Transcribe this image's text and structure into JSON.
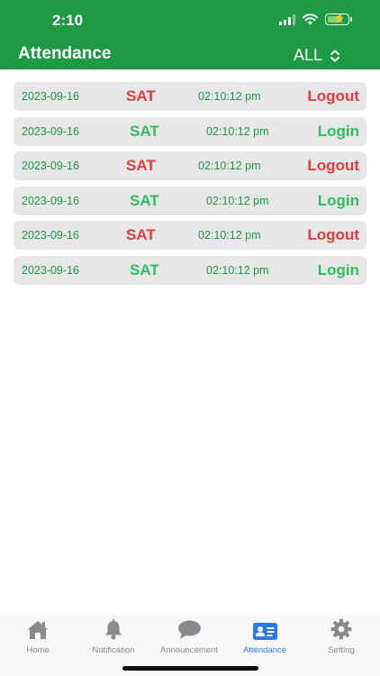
{
  "status_bar": {
    "time": "2:10"
  },
  "header": {
    "title": "Attendance",
    "filter_value": "ALL"
  },
  "records": [
    {
      "date": "2023-09-16",
      "day": "SAT",
      "time": "02:10:12 pm",
      "action": "Logout",
      "type": "logout"
    },
    {
      "date": "2023-09-16",
      "day": "SAT",
      "time": "02:10:12 pm",
      "action": "Login",
      "type": "login"
    },
    {
      "date": "2023-09-16",
      "day": "SAT",
      "time": "02:10:12 pm",
      "action": "Logout",
      "type": "logout"
    },
    {
      "date": "2023-09-16",
      "day": "SAT",
      "time": "02:10:12 pm",
      "action": "Login",
      "type": "login"
    },
    {
      "date": "2023-09-16",
      "day": "SAT",
      "time": "02:10:12 pm",
      "action": "Logout",
      "type": "logout"
    },
    {
      "date": "2023-09-16",
      "day": "SAT",
      "time": "02:10:12 pm",
      "action": "Login",
      "type": "login"
    }
  ],
  "tabbar": {
    "items": [
      {
        "label": "Home",
        "icon": "home-icon"
      },
      {
        "label": "Notification",
        "icon": "bell-icon"
      },
      {
        "label": "Announcement",
        "icon": "chat-bubble-icon"
      },
      {
        "label": "Attendance",
        "icon": "id-card-icon"
      },
      {
        "label": "Setting",
        "icon": "gear-icon"
      }
    ],
    "active": "Attendance"
  },
  "colors": {
    "header_green": "#1f9a44",
    "logout_red": "#e63b3b",
    "login_green": "#2fbf5a",
    "date_green": "#1e9a44",
    "row_gray": "#e7e7e9",
    "tab_active_blue": "#2c7be5",
    "tab_inactive_gray": "#8a8a8e"
  }
}
